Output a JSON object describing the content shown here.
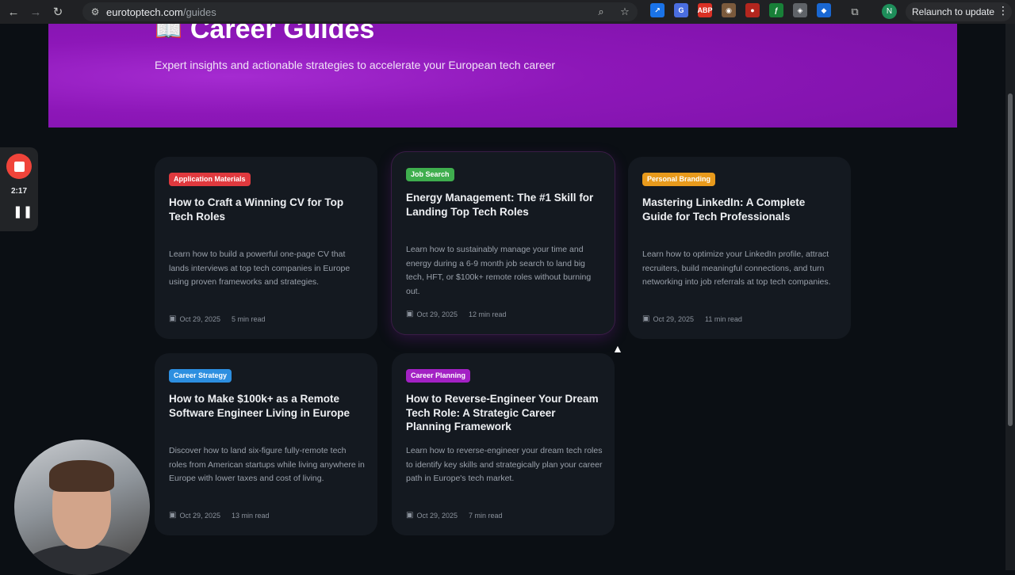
{
  "browser": {
    "url_host": "eurotoptech.com",
    "url_path": "/guides",
    "profile_initial": "N",
    "relaunch_label": "Relaunch to update",
    "extensions": [
      {
        "label": "↗",
        "color": "#1a73e8"
      },
      {
        "label": "G",
        "color": "#4a6ee0"
      },
      {
        "label": "ABP",
        "color": "#d93025"
      },
      {
        "label": "◉",
        "color": "#7b5a3c"
      },
      {
        "label": "●",
        "color": "#b3261e"
      },
      {
        "label": "ƒ",
        "color": "#188038"
      },
      {
        "label": "◈",
        "color": "#5f6368"
      },
      {
        "label": "◆",
        "color": "#1967d2"
      }
    ]
  },
  "hero": {
    "title": "Career Guides",
    "subtitle": "Expert insights and actionable strategies to accelerate your European tech career"
  },
  "recorder": {
    "time": "2:17"
  },
  "guides": [
    {
      "tag": "Application Materials",
      "tag_color": "#e0393e",
      "title": "How to Craft a Winning CV for Top Tech Roles",
      "description": "Learn how to build a powerful one-page CV that lands interviews at top tech companies in Europe using proven frameworks and strategies.",
      "date": "Oct 29, 2025",
      "read_time": "5 min read"
    },
    {
      "tag": "Job Search",
      "tag_color": "#3fae4e",
      "title": "Energy Management: The #1 Skill for Landing Top Tech Roles",
      "description": "Learn how to sustainably manage your time and energy during a 6-9 month job search to land big tech, HFT, or $100k+ remote roles without burning out.",
      "date": "Oct 29, 2025",
      "read_time": "12 min read"
    },
    {
      "tag": "Personal Branding",
      "tag_color": "#e89a1c",
      "title": "Mastering LinkedIn: A Complete Guide for Tech Professionals",
      "description": "Learn how to optimize your LinkedIn profile, attract recruiters, build meaningful connections, and turn networking into job referrals at top tech companies.",
      "date": "Oct 29, 2025",
      "read_time": "11 min read"
    },
    {
      "tag": "Career Strategy",
      "tag_color": "#2d8fe0",
      "title": "How to Make $100k+ as a Remote Software Engineer Living in Europe",
      "description": "Discover how to land six-figure fully-remote tech roles from American startups while living anywhere in Europe with lower taxes and cost of living.",
      "date": "Oct 29, 2025",
      "read_time": "13 min read"
    },
    {
      "tag": "Career Planning",
      "tag_color": "#a321c4",
      "title": "How to Reverse-Engineer Your Dream Tech Role: A Strategic Career Planning Framework",
      "description": "Learn how to reverse-engineer your dream tech roles to identify key skills and strategically plan your career path in Europe's tech market.",
      "date": "Oct 29, 2025",
      "read_time": "7 min read"
    }
  ]
}
